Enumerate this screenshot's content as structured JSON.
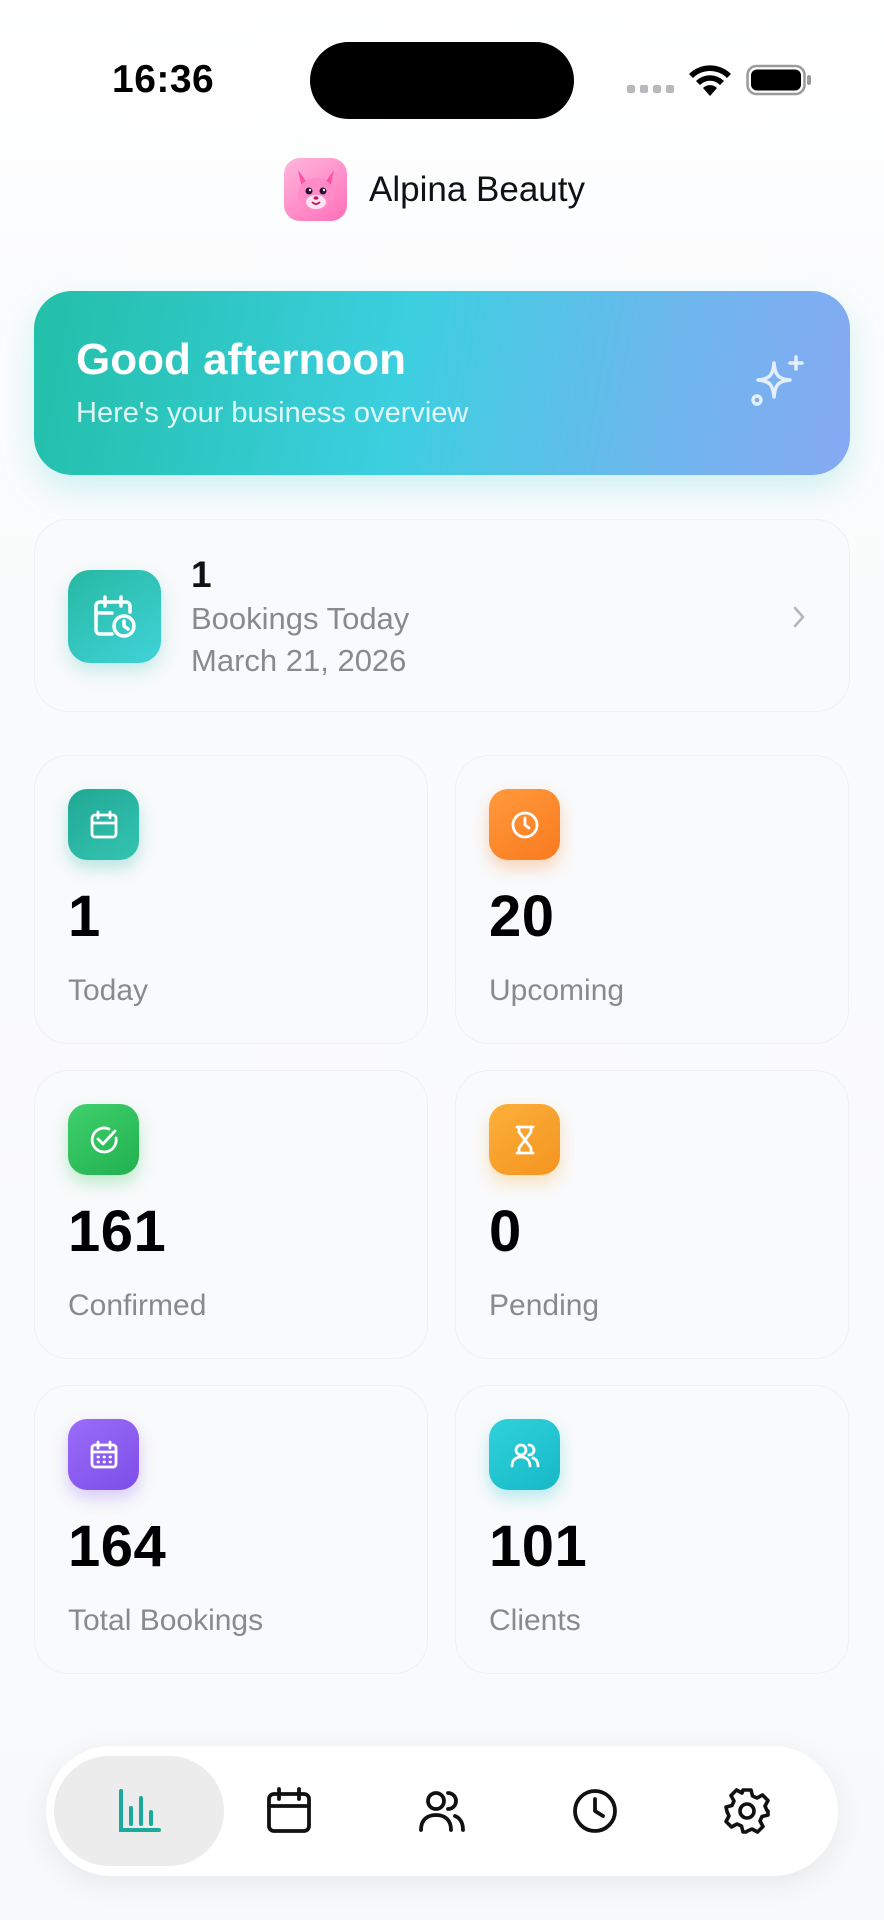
{
  "status_bar": {
    "time": "16:36"
  },
  "header": {
    "app_name": "Alpina Beauty",
    "logo_icon": "pink-fox-mascot-icon"
  },
  "hero": {
    "title": "Good afternoon",
    "subtitle": "Here's your business overview",
    "icon": "sparkle-icon"
  },
  "today_card": {
    "count": "1",
    "label": "Bookings Today",
    "date": "March 21, 2026",
    "icon": "calendar-clock-icon"
  },
  "stats": [
    {
      "value": "1",
      "label": "Today",
      "icon": "calendar-icon",
      "color": "#26b6a2"
    },
    {
      "value": "20",
      "label": "Upcoming",
      "icon": "clock-icon",
      "color": "#fb8c2e"
    },
    {
      "value": "161",
      "label": "Confirmed",
      "icon": "check-circle-icon",
      "color": "#2ec760"
    },
    {
      "value": "0",
      "label": "Pending",
      "icon": "hourglass-icon",
      "color": "#f9a52d"
    },
    {
      "value": "164",
      "label": "Total Bookings",
      "icon": "calendar-grid-icon",
      "color": "#8b5cf6"
    },
    {
      "value": "101",
      "label": "Clients",
      "icon": "users-icon",
      "color": "#1ec6d2"
    }
  ],
  "tabbar": {
    "tabs": [
      {
        "name": "dashboard",
        "icon": "bar-chart-icon",
        "active": true
      },
      {
        "name": "calendar",
        "icon": "calendar-icon",
        "active": false
      },
      {
        "name": "clients",
        "icon": "users-icon",
        "active": false
      },
      {
        "name": "history",
        "icon": "clock-icon",
        "active": false
      },
      {
        "name": "settings",
        "icon": "gear-icon",
        "active": false
      }
    ],
    "accent": "#1aa99a"
  }
}
